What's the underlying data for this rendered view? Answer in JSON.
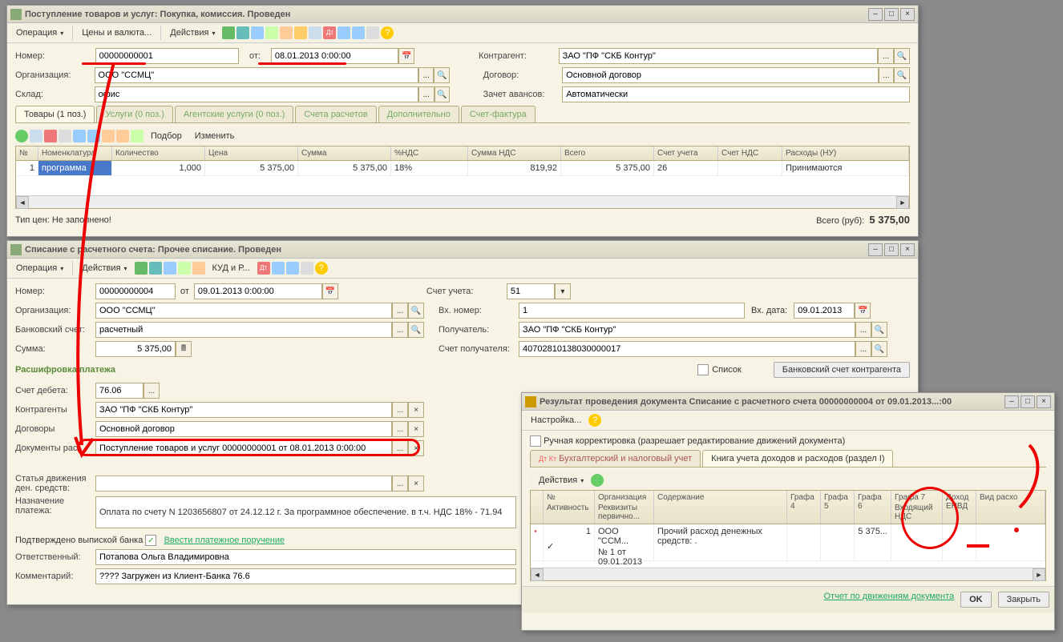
{
  "w1": {
    "title": "Поступление товаров и услуг: Покупка, комиссия. Проведен",
    "tb": {
      "op": "Операция",
      "price": "Цены и валюта...",
      "act": "Действия"
    },
    "f": {
      "num_l": "Номер:",
      "num": "00000000001",
      "from": "от:",
      "date": "08.01.2013 0:00:00",
      "org_l": "Организация:",
      "org": "ООО \"ССМЦ\"",
      "wh_l": "Склад:",
      "wh": "офис",
      "ca_l": "Контрагент:",
      "ca": "ЗАО \"ПФ \"СКБ Контур\"",
      "dog_l": "Договор:",
      "dog": "Основной договор",
      "adv_l": "Зачет авансов:",
      "adv": "Автоматически"
    },
    "tabs": [
      "Товары (1 поз.)",
      "Услуги (0 поз.)",
      "Агентские услуги (0 поз.)",
      "Счета расчетов",
      "Дополнительно",
      "Счет-фактура"
    ],
    "gb": {
      "pick": "Подбор",
      "edit": "Изменить"
    },
    "cols": [
      "№",
      "Номенклатура",
      "Количество",
      "Цена",
      "Сумма",
      "%НДС",
      "Сумма НДС",
      "Всего",
      "Счет учета",
      "Счет НДС",
      "Расходы (НУ)"
    ],
    "row": {
      "n": "1",
      "nom": "программа",
      "qty": "1,000",
      "price": "5 375,00",
      "sum": "5 375,00",
      "vat": "18%",
      "vatsum": "819,92",
      "total": "5 375,00",
      "acc": "26",
      "accv": "",
      "exp": "Принимаются"
    },
    "pt_l": "Тип цен: Не заполнено!",
    "tot_l": "Всего (руб):",
    "tot": "5 375,00"
  },
  "w2": {
    "title": "Списание с расчетного счета: Прочее списание. Проведен",
    "tb": {
      "op": "Операция",
      "act": "Действия",
      "kud": "КУД и Р..."
    },
    "f": {
      "num_l": "Номер:",
      "num": "00000000004",
      "from": "от",
      "date": "09.01.2013 0:00:00",
      "org_l": "Организация:",
      "org": "ООО \"ССМЦ\"",
      "bank_l": "Банковский счет:",
      "bank": "расчетный",
      "sum_l": "Сумма:",
      "sum": "5 375,00",
      "acc_l": "Счет учета:",
      "acc": "51",
      "inum_l": "Вх. номер:",
      "inum": "1",
      "idate_l": "Вх. дата:",
      "idate": "09.01.2013",
      "rec_l": "Получатель:",
      "rec": "ЗАО \"ПФ \"СКБ Контур\"",
      "racc_l": "Счет получателя:",
      "racc": "40702810138030000017"
    },
    "sec": "Расшифровка платежа",
    "list": "Список",
    "bankacc": "Банковский счет контрагента",
    "p": {
      "deb_l": "Счет дебета:",
      "deb": "76.06",
      "ca_l": "Контрагенты",
      "ca": "ЗАО \"ПФ \"СКБ Контур\"",
      "dog_l": "Договоры",
      "dog": "Основной договор",
      "doc_l": "Документы рас...",
      "doc": "Поступление товаров и услуг 00000000001 от 08.01.2013 0:00:00",
      "mov_l": "Статья движения ден. средств:",
      "pay_l": "Назначение платежа:",
      "pay": "Оплата по счету N 1203656807 от 24.12.12 г. За программное обеспечение. в т.ч. НДС 18% - 71.94"
    },
    "conf": "Подтверждено выпиской банка",
    "enter": "Ввести платежное поручение",
    "resp_l": "Ответственный:",
    "resp": "Потапова Ольга Владимировна",
    "com_l": "Комментарий:",
    "com": "???? Загружен из Клиент-Банка 76.6"
  },
  "w3": {
    "title": "Результат проведения документа Списание с расчетного счета 00000000004 от 09.01.2013...:00",
    "set": "Настройка...",
    "man": "Ручная корректировка (разрешает редактирование движений документа)",
    "tabs": [
      "Бухгалтерский и налоговый учет",
      "Книга учета доходов и расходов (раздел I)"
    ],
    "act": "Действия",
    "cols": {
      "n": "№",
      "act": "Активность",
      "org": "Организация",
      "req": "Реквизиты первично...",
      "cont": "Содержание",
      "g4": "Графа 4",
      "g5": "Графа 5",
      "g6": "Графа 6",
      "g7": "Графа 7",
      "vat": "Входящий НДС",
      "doh": "Доход ЕНВД",
      "vid": "Вид расхо"
    },
    "row": {
      "n": "1",
      "org": "ООО \"ССМ...",
      "req": "№ 1 от 09.01.2013",
      "cont": "Прочий расход денежных средств: .",
      "g6": "5 375..."
    },
    "rep": "Отчет по движениям документа",
    "ok": "OK",
    "close": "Закрыть"
  }
}
